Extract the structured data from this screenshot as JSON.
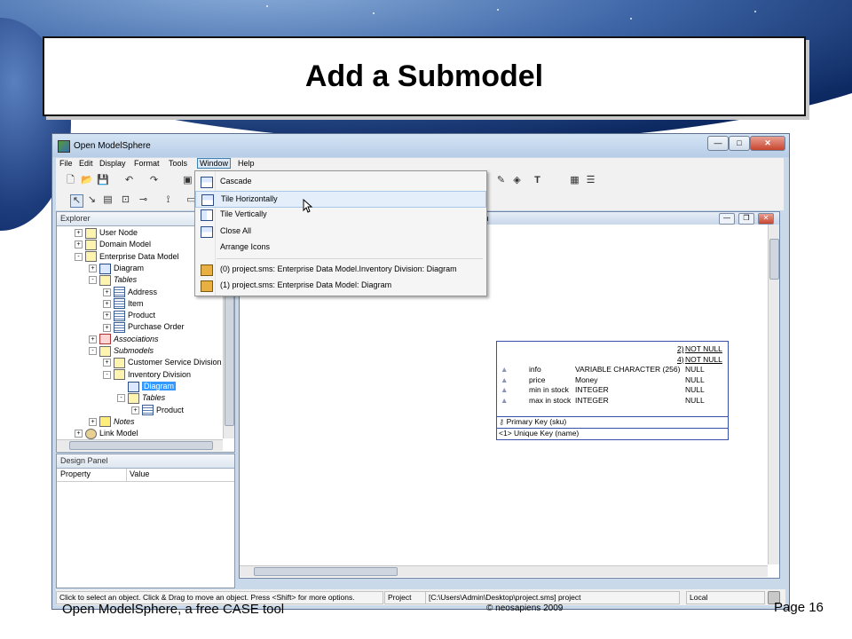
{
  "slide": {
    "title": "Add a Submodel",
    "footer_left": "Open ModelSphere, a free CASE tool",
    "footer_mid": "© neosapiens 2009",
    "footer_right": "Page 16"
  },
  "app": {
    "window_title": "Open ModelSphere",
    "menu": [
      "File",
      "Edit",
      "Display",
      "Format",
      "Tools",
      "Window",
      "Help"
    ],
    "active_menu": "Window"
  },
  "explorer": {
    "title": "Explorer",
    "items": [
      {
        "label": "User Node",
        "icon": "folder-icon",
        "expander": "+"
      },
      {
        "label": "Domain Model",
        "icon": "folder-icon",
        "expander": "+"
      },
      {
        "label": "Enterprise Data Model",
        "icon": "folder-icon",
        "expander": "-"
      },
      {
        "label": "Diagram",
        "icon": "diagram-icon",
        "expander": "+"
      },
      {
        "label": "Tables",
        "icon": "folder-icon",
        "expander": "-"
      },
      {
        "label": "Address",
        "icon": "table-icon",
        "expander": "+"
      },
      {
        "label": "Item",
        "icon": "table-icon",
        "expander": "+"
      },
      {
        "label": "Product",
        "icon": "table-icon",
        "expander": "+"
      },
      {
        "label": "Purchase Order",
        "icon": "table-icon",
        "expander": "+"
      },
      {
        "label": "Associations",
        "icon": "association-icon",
        "expander": "+"
      },
      {
        "label": "Submodels",
        "icon": "folder-icon",
        "expander": "-"
      },
      {
        "label": "Customer Service Division",
        "icon": "folder-icon",
        "expander": "+"
      },
      {
        "label": "Inventory Division",
        "icon": "folder-icon",
        "expander": "-"
      },
      {
        "label": "Diagram",
        "icon": "diagram-icon",
        "expander": ""
      },
      {
        "label": "Tables",
        "icon": "folder-icon",
        "expander": "-"
      },
      {
        "label": "Product",
        "icon": "table-icon",
        "expander": "+"
      },
      {
        "label": "Notes",
        "icon": "notes-icon",
        "expander": "+"
      },
      {
        "label": "Link Model",
        "icon": "link-icon",
        "expander": "+"
      }
    ]
  },
  "design_panel": {
    "title": "Design Panel",
    "col_property": "Property",
    "col_value": "Value"
  },
  "diagram_window": {
    "title_fragment": "am"
  },
  "window_menu": {
    "items": [
      {
        "label": "Cascade",
        "icon": "cascade-icon"
      },
      {
        "label": "Tile Horizontally",
        "icon": "tile-horizontal-icon"
      },
      {
        "label": "Tile Vertically",
        "icon": "tile-vertical-icon"
      },
      {
        "label": "Close All",
        "icon": "close-all-icon"
      },
      {
        "label": "Arrange Icons",
        "icon": ""
      }
    ],
    "recent": [
      {
        "label": "(0) project.sms: Enterprise Data Model.Inventory Division: Diagram",
        "icon": "diagram-folder-icon"
      },
      {
        "label": "(1) project.sms: Enterprise Data Model: Diagram",
        "icon": "diagram-folder-icon"
      }
    ],
    "highlighted": "Tile Horizontally"
  },
  "entity": {
    "rows": [
      {
        "name": "",
        "type": "2)",
        "nullability": "NOT NULL"
      },
      {
        "name": "",
        "type": "4)",
        "nullability": "NOT NULL"
      },
      {
        "name": "info",
        "type": "VARIABLE CHARACTER (256)",
        "nullability": "NULL"
      },
      {
        "name": "price",
        "type": "Money",
        "nullability": "NULL"
      },
      {
        "name": "min in stock",
        "type": "INTEGER",
        "nullability": "NULL"
      },
      {
        "name": "max in stock",
        "type": "INTEGER",
        "nullability": "NULL"
      }
    ],
    "primary_key": "Primary Key (sku)",
    "unique_key": "<1> Unique Key (name)"
  },
  "statusbar": {
    "hint": "Click to select an object.  Click & Drag to move an object.  Press <Shift> for more options.",
    "project_label": "Project",
    "project_path": "[C:\\Users\\Admin\\Desktop\\project.sms]  project",
    "location": "Local"
  }
}
